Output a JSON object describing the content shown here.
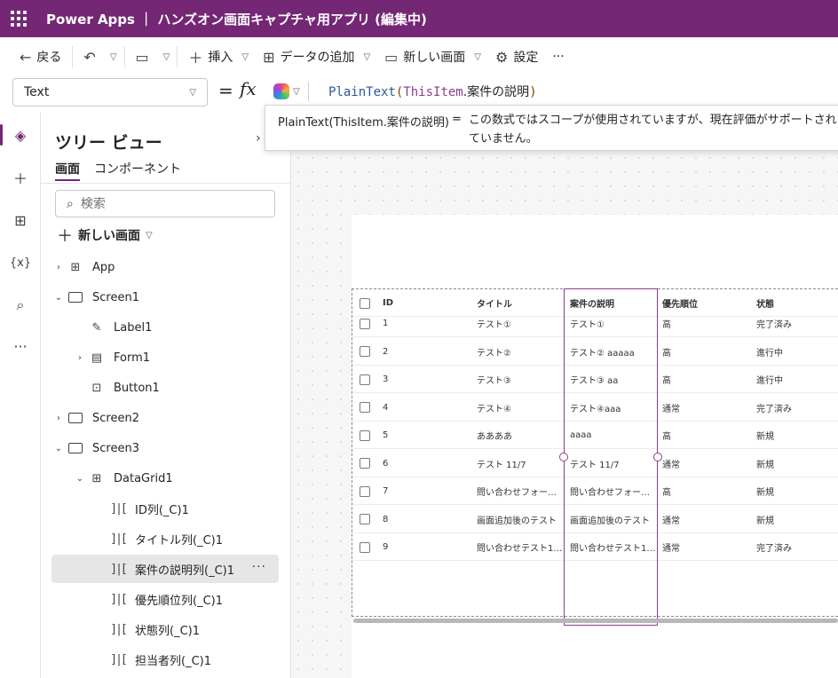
{
  "titlebar": {
    "title": "Power Apps ｜ ハンズオン画面キャプチャ用アプリ (編集中)"
  },
  "toolbar": {
    "back": "戻る",
    "insert": "挿入",
    "add_data": "データの追加",
    "new_screen": "新しい画面",
    "settings": "設定",
    "more": "···"
  },
  "formula": {
    "property": "Text",
    "eq": "=",
    "fx": "fx",
    "fn": "PlainText",
    "open": "(",
    "obj": "ThisItem",
    "dot": ".",
    "field": "案件の説明",
    "close": ")"
  },
  "tooltip": {
    "expr": "PlainText(ThisItem.案件の説明)",
    "eq": "=",
    "message": "この数式ではスコープが使用されていますが、現在評価がサポートされていません。"
  },
  "tree": {
    "title": "ツリー ビュー",
    "tabs": [
      "画面",
      "コンポーネント"
    ],
    "search_placeholder": "検索",
    "new_screen": "新しい画面",
    "nodes": [
      "App",
      "Screen1",
      "Label1",
      "Form1",
      "Button1",
      "Screen2",
      "Screen3",
      "DataGrid1",
      "ID列(_C)1",
      "タイトル列(_C)1",
      "案件の説明列(_C)1",
      "優先順位列(_C)1",
      "状態列(_C)1",
      "担当者列(_C)1"
    ],
    "more": "···"
  },
  "grid": {
    "headers": [
      "ID",
      "タイトル",
      "案件の説明",
      "優先順位",
      "状態"
    ],
    "rows": [
      [
        "1",
        "テスト①",
        "テスト①",
        "高",
        "完了済み"
      ],
      [
        "2",
        "テスト②",
        "テスト② aaaaa",
        "高",
        "進行中"
      ],
      [
        "3",
        "テスト③",
        "テスト③ aa",
        "高",
        "進行中"
      ],
      [
        "4",
        "テスト④",
        "テスト④aaa",
        "通常",
        "完了済み"
      ],
      [
        "5",
        "ああああ",
        "aaaa",
        "高",
        "新規"
      ],
      [
        "6",
        "テスト 11/7",
        "テスト 11/7",
        "通常",
        "新規"
      ],
      [
        "7",
        "問い合わせフォー…",
        "問い合わせフォー…",
        "高",
        "新規"
      ],
      [
        "8",
        "画面追加後のテスト",
        "画面追加後のテスト",
        "通常",
        "新規"
      ],
      [
        "9",
        "問い合わせテスト1…",
        "問い合わせテスト1…",
        "通常",
        "完了済み"
      ]
    ]
  },
  "colors": {
    "accent": "#742774",
    "selection": "#8e3c8e"
  }
}
